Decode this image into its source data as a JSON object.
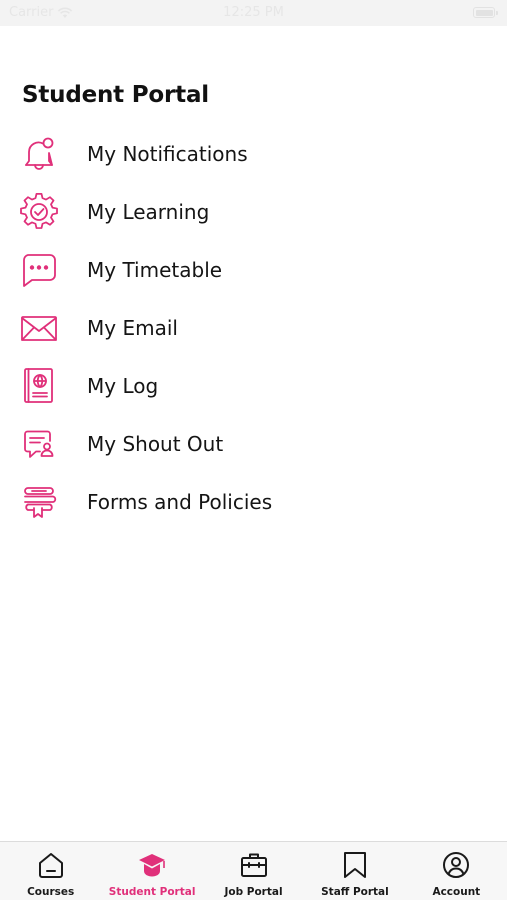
{
  "status_bar": {
    "carrier": "Carrier",
    "time": "12:25 PM",
    "battery_level": 1.0
  },
  "page": {
    "title": "Student Portal"
  },
  "theme": {
    "accent": "#e0307a",
    "text": "#151515"
  },
  "menu": [
    {
      "label": "My Notifications",
      "icon": "bell-icon"
    },
    {
      "label": "My Learning",
      "icon": "gear-icon"
    },
    {
      "label": "My Timetable",
      "icon": "chat-bubble-icon"
    },
    {
      "label": "My Email",
      "icon": "envelope-icon"
    },
    {
      "label": "My Log",
      "icon": "passport-icon"
    },
    {
      "label": "My Shout Out",
      "icon": "message-user-icon"
    },
    {
      "label": "Forms and Policies",
      "icon": "stacked-documents-icon"
    }
  ],
  "tab_bar": {
    "tabs": [
      {
        "label": "Courses",
        "icon": "home-icon",
        "active": false
      },
      {
        "label": "Student Portal",
        "icon": "graduation-cap-icon",
        "active": true
      },
      {
        "label": "Job Portal",
        "icon": "briefcase-icon",
        "active": false
      },
      {
        "label": "Staff Portal",
        "icon": "bookmark-icon",
        "active": false
      },
      {
        "label": "Account",
        "icon": "user-circle-icon",
        "active": false
      }
    ]
  }
}
